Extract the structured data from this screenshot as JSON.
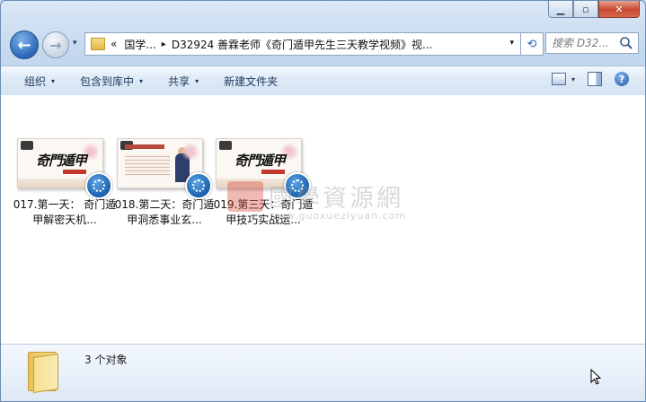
{
  "window": {
    "minimize_glyph": "▁",
    "maximize_glyph": "▫",
    "close_glyph": "✕"
  },
  "nav": {
    "back_glyph": "←",
    "forward_glyph": "→",
    "history_glyph": "▾",
    "breadcrumb": {
      "overflow": "«",
      "item1": "国学...",
      "separator": "▸",
      "item2": "D32924  善霖老师《奇门遁甲先生三天教学视频》视..."
    },
    "address_dropdown_glyph": "▾",
    "refresh_glyph": "⟲",
    "search_placeholder": "搜索 D32..."
  },
  "toolbar": {
    "organize": "组织",
    "include_in_library": "包含到库中",
    "share": "共享",
    "new_folder": "新建文件夹",
    "arrow": "▾",
    "help": "?"
  },
  "files": [
    {
      "name": "017.第一天： 奇门遁甲解密天机...",
      "thumb_text": "奇門遁甲",
      "icon": "video-file-icon"
    },
    {
      "name": "018.第二天：奇门遁甲洞悉事业玄...",
      "thumb_text": "",
      "icon": "video-file-icon"
    },
    {
      "name": "019.第三天：奇门遁甲技巧实战运...",
      "thumb_text": "奇門遁甲",
      "icon": "video-file-icon"
    }
  ],
  "watermark": {
    "text": "國學資源網",
    "url": "www.guoxueziyuan.com"
  },
  "details": {
    "count": "3 个对象"
  },
  "colors": {
    "accent": "#2a67b8",
    "close_button": "#c9472d",
    "folder": "#e9c15a"
  }
}
